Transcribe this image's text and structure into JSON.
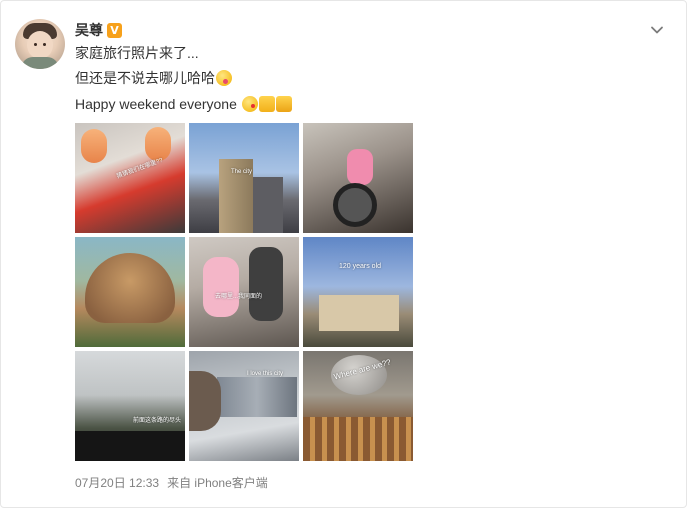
{
  "post": {
    "author_name": "吴尊",
    "verified_badge": "V",
    "lines": [
      "家庭旅行照片来了...",
      "但还是不说去哪儿哈哈",
      "Happy weekend everyone"
    ],
    "emoji": {
      "line2": [
        "tongue-wink-emoji"
      ],
      "line3": [
        "kiss-emoji",
        "thumbs-up-emoji",
        "flexed-biceps-emoji"
      ]
    },
    "photos": [
      {
        "caption": "猜猜我们在哪里??"
      },
      {
        "caption": "The city"
      },
      {
        "caption": ""
      },
      {
        "caption": ""
      },
      {
        "caption": "去哪里...我同面的"
      },
      {
        "caption": "120 years old"
      },
      {
        "caption": "前面这条路的尽头"
      },
      {
        "caption": "I love this city"
      },
      {
        "caption": "Where are we??"
      }
    ],
    "timestamp": "07月20日 12:33",
    "source": "来自 iPhone客户端"
  },
  "colors": {
    "text": "#333333",
    "meta": "#808080",
    "verified": "#f7a11b",
    "border": "#e6e6e6"
  }
}
